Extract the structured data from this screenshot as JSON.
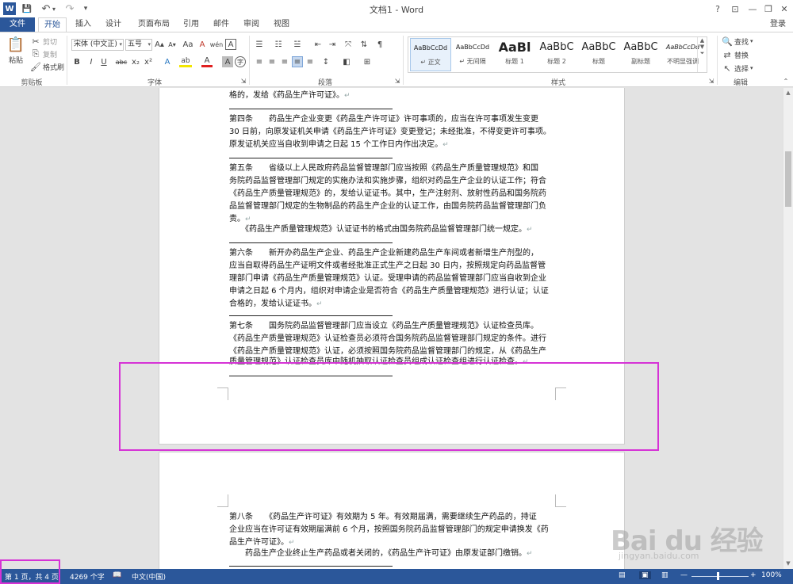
{
  "window": {
    "title": "文档1 - Word",
    "help": "?",
    "minimize": "—",
    "restore": "❐",
    "close": "✕",
    "ribbon_display": "⊡"
  },
  "quick_access": {
    "word_icon": "W",
    "save": "💾",
    "undo": "↶",
    "redo": "↷",
    "customize": "▾"
  },
  "tabs": [
    "文件",
    "开始",
    "插入",
    "设计",
    "页面布局",
    "引用",
    "邮件",
    "审阅",
    "视图"
  ],
  "user": "登录",
  "ribbon": {
    "clipboard": {
      "paste": "粘贴",
      "cut": "剪切",
      "copy": "复制",
      "format_painter": "格式刷",
      "label": "剪贴板"
    },
    "font": {
      "name": "宋体 (中文正)",
      "size": "五号",
      "grow": "A▴",
      "shrink": "A▾",
      "case": "Aa",
      "clear": "A",
      "wen": "wén",
      "border_char": "A",
      "bold": "B",
      "italic": "I",
      "underline": "U",
      "strike": "abc",
      "sub": "x₂",
      "sup": "x²",
      "effects": "A",
      "highlight": "ab",
      "color": "A",
      "shading": "A",
      "circle": "字",
      "label": "字体"
    },
    "paragraph": {
      "label": "段落"
    },
    "styles": {
      "label": "样式",
      "items": [
        {
          "preview": "AaBbCcDd",
          "name": "↵ 正文"
        },
        {
          "preview": "AaBbCcDd",
          "name": "↵ 无间隔"
        },
        {
          "preview": "AaBl",
          "name": "标题 1"
        },
        {
          "preview": "AaBbC",
          "name": "标题 2"
        },
        {
          "preview": "AaBbC",
          "name": "标题"
        },
        {
          "preview": "AaBbC",
          "name": "副标题"
        },
        {
          "preview": "AaBbCcDd",
          "name": "不明显强调"
        }
      ]
    },
    "editing": {
      "find": "查找",
      "replace": "替换",
      "select": "选择",
      "label": "编辑"
    }
  },
  "document": {
    "lines": [
      "格的，发给《药品生产许可证》。",
      "第四条　　药品生产企业变更《药品生产许可证》许可事项的，应当在许可事项发生变更",
      "30 日前，向原发证机关申请《药品生产许可证》变更登记；未经批准，不得变更许可事项。",
      "原发证机关应当自收到申请之日起 15 个工作日内作出决定。",
      "第五条　　省级以上人民政府药品监督管理部门应当按照《药品生产质量管理规范》和国",
      "务院药品监督管理部门规定的实施办法和实施步骤，组织对药品生产企业的认证工作；符合",
      "《药品生产质量管理规范》的，发给认证证书。其中，生产注射剂、放射性药品和国务院药",
      "品监督管理部门规定的生物制品的药品生产企业的认证工作，由国务院药品监督管理部门负",
      "责。",
      "　　《药品生产质量管理规范》认证证书的格式由国务院药品监督管理部门统一规定。",
      "第六条　　新开办药品生产企业、药品生产企业新建药品生产车间或者新增生产剂型的，",
      "应当自取得药品生产证明文件或者经批准正式生产之日起 30 日内，按照规定向药品监督管",
      "理部门申请《药品生产质量管理规范》认证。受理申请的药品监督管理部门应当自收到企业",
      "申请之日起 6 个月内，组织对申请企业是否符合《药品生产质量管理规范》进行认证；认证",
      "合格的，发给认证证书。",
      "第七条　　国务院药品监督管理部门应当设立《药品生产质量管理规范》认证检查员库。",
      "《药品生产质量管理规范》认证检查员必须符合国务院药品监督管理部门规定的条件。进行",
      "《药品生产质量管理规范》认证，必须按照国务院药品监督管理部门的规定，从《药品生产",
      "质量管理规范》认证检查员库中随机抽取认证检查员组成认证检查组进行认证检查。",
      "第八条　　《药品生产许可证》有效期为 5 年。有效期届满，需要继续生产药品的，持证",
      "企业应当在许可证有效期届满前 6 个月，按照国务院药品监督管理部门的规定申请换发《药",
      "品生产许可证》。",
      "　　药品生产企业终止生产药品或者关闭的，《药品生产许可证》由原发证部门缴销。"
    ],
    "para_mark": "↵"
  },
  "statusbar": {
    "page": "第 1 页，共 4 页",
    "words": "4269 个字",
    "language": "中文(中国)",
    "zoom": "100%",
    "zoom_minus": "—",
    "zoom_plus": "+"
  },
  "watermark": {
    "text": "Bai du 经验",
    "url": "jingyan.baidu.com"
  },
  "colors": {
    "accent": "#2b579a",
    "highlight_box": "#d633d6"
  }
}
